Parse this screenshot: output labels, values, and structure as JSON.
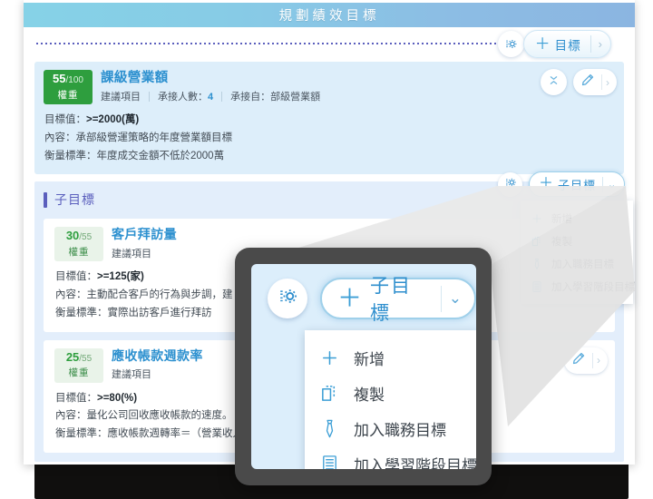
{
  "header": {
    "title": "規劃績效目標"
  },
  "toolbar": {
    "gear_icon": "settings-gear-icon",
    "add_goal_label": "目標",
    "add_goal_plus": "＋",
    "caret_right": "›"
  },
  "goal": {
    "weight": {
      "num": "55",
      "den": "/100",
      "label": "權重"
    },
    "title": "課級營業額",
    "meta": [
      {
        "text": "建議項目"
      },
      {
        "text": "承接人數：",
        "value": "4"
      },
      {
        "text": "承接自：部級營業額"
      }
    ],
    "lines": [
      {
        "label": "目標值：",
        "value": ">=2000(萬)",
        "bold": true
      },
      {
        "label": "內容：",
        "value": "承部級營運策略的年度營業額目標",
        "bold": false
      },
      {
        "label": "衡量標準：",
        "value": "年度成交金額不低於2000萬",
        "bold": false
      }
    ],
    "actions": {
      "collapse_icon": "collapse-chevrons-icon",
      "edit_icon": "pencil-edit-icon",
      "caret_right": "›"
    }
  },
  "sub_section": {
    "heading": "子目標",
    "add_sub_goal_label": "子目標",
    "add_sub_goal_plus": "＋",
    "caret_down": "⌄",
    "gear_icon": "settings-gear-icon",
    "menu": [
      {
        "label": "新增",
        "icon": "plus-icon"
      },
      {
        "label": "複製",
        "icon": "copy-icon"
      },
      {
        "label": "加入職務目標",
        "icon": "necktie-job-icon"
      },
      {
        "label": "加入學習階段目標",
        "icon": "book-learning-icon"
      }
    ],
    "cards": [
      {
        "weight": {
          "num": "30",
          "den": "/55",
          "label": "權重"
        },
        "title": "客戶拜訪量",
        "meta": [
          {
            "text": "建議項目"
          }
        ],
        "lines": [
          {
            "label": "目標值：",
            "value": ">=125(家)",
            "bold": true
          },
          {
            "label": "內容：",
            "value": "主動配合客戶的行為與步調，建",
            "bold": false
          },
          {
            "label": "衡量標準：",
            "value": "實際出訪客戶進行拜訪",
            "bold": false
          }
        ]
      },
      {
        "weight": {
          "num": "25",
          "den": "/55",
          "label": "權重"
        },
        "title": "應收帳款週款率",
        "meta": [
          {
            "text": "建議項目"
          }
        ],
        "lines": [
          {
            "label": "目標值：",
            "value": ">=80(%)",
            "bold": true
          },
          {
            "label": "內容：",
            "value": "量化公司回收應收帳款的速度。",
            "bold": false
          },
          {
            "label": "衡量標準：",
            "value": "應收帳款週轉率＝（營業收入",
            "bold": false
          }
        ],
        "actions": {
          "edit_icon": "pencil-edit-icon",
          "caret_right": "›"
        }
      }
    ]
  },
  "magnifier": {
    "gear_icon": "settings-gear-icon",
    "add_sub_goal_plus": "＋",
    "add_sub_goal_label": "子目標",
    "caret_down": "⌄",
    "menu": [
      {
        "label": "新增",
        "icon": "plus-icon"
      },
      {
        "label": "複製",
        "icon": "copy-icon"
      },
      {
        "label": "加入職務目標",
        "icon": "necktie-job-icon"
      },
      {
        "label": "加入學習階段目標",
        "icon": "book-learning-icon"
      }
    ]
  },
  "colors": {
    "header_gradient_start": "#86d2e7",
    "header_gradient_end": "#8bb5e1",
    "accent_blue": "#2c90cf",
    "weight_green": "#2e9e3e",
    "sub_purple": "#5b5fbd",
    "card_blue": "#ddeefa",
    "sub_section_blue": "#e3eefb"
  }
}
